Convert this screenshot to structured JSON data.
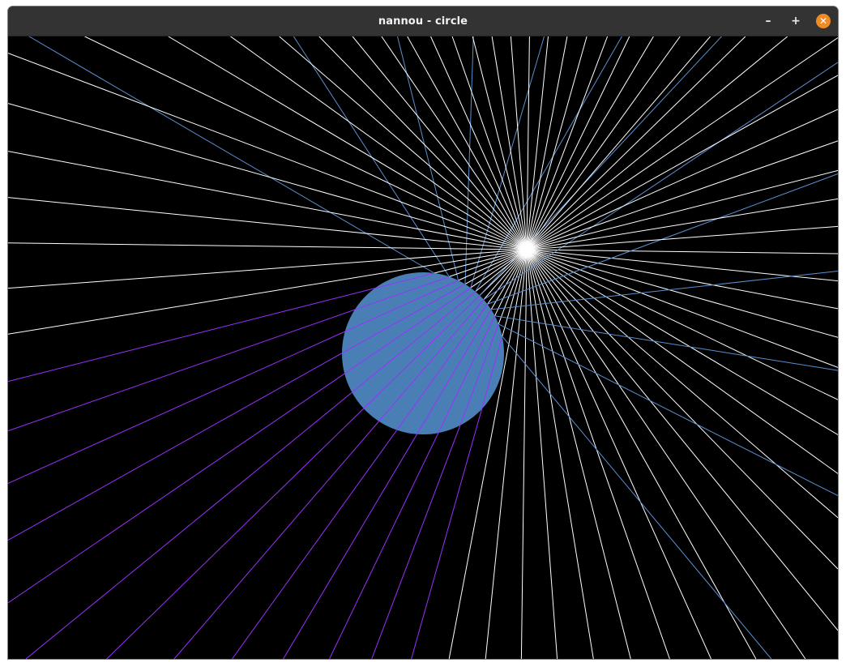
{
  "window": {
    "title": "nannou - circle",
    "controls": {
      "minimize_symbol": "–",
      "maximize_symbol": "+",
      "close_symbol": "✕"
    },
    "colors": {
      "titlebar": "#333333",
      "close_button": "#f08a24"
    }
  },
  "scene": {
    "background_color": "#000000",
    "circle_color": "#4a7fb5",
    "ray_color_white": "#ffffff",
    "ray_color_blue": "#5b8fd0",
    "ray_color_purple": "#9b30ff"
  }
}
